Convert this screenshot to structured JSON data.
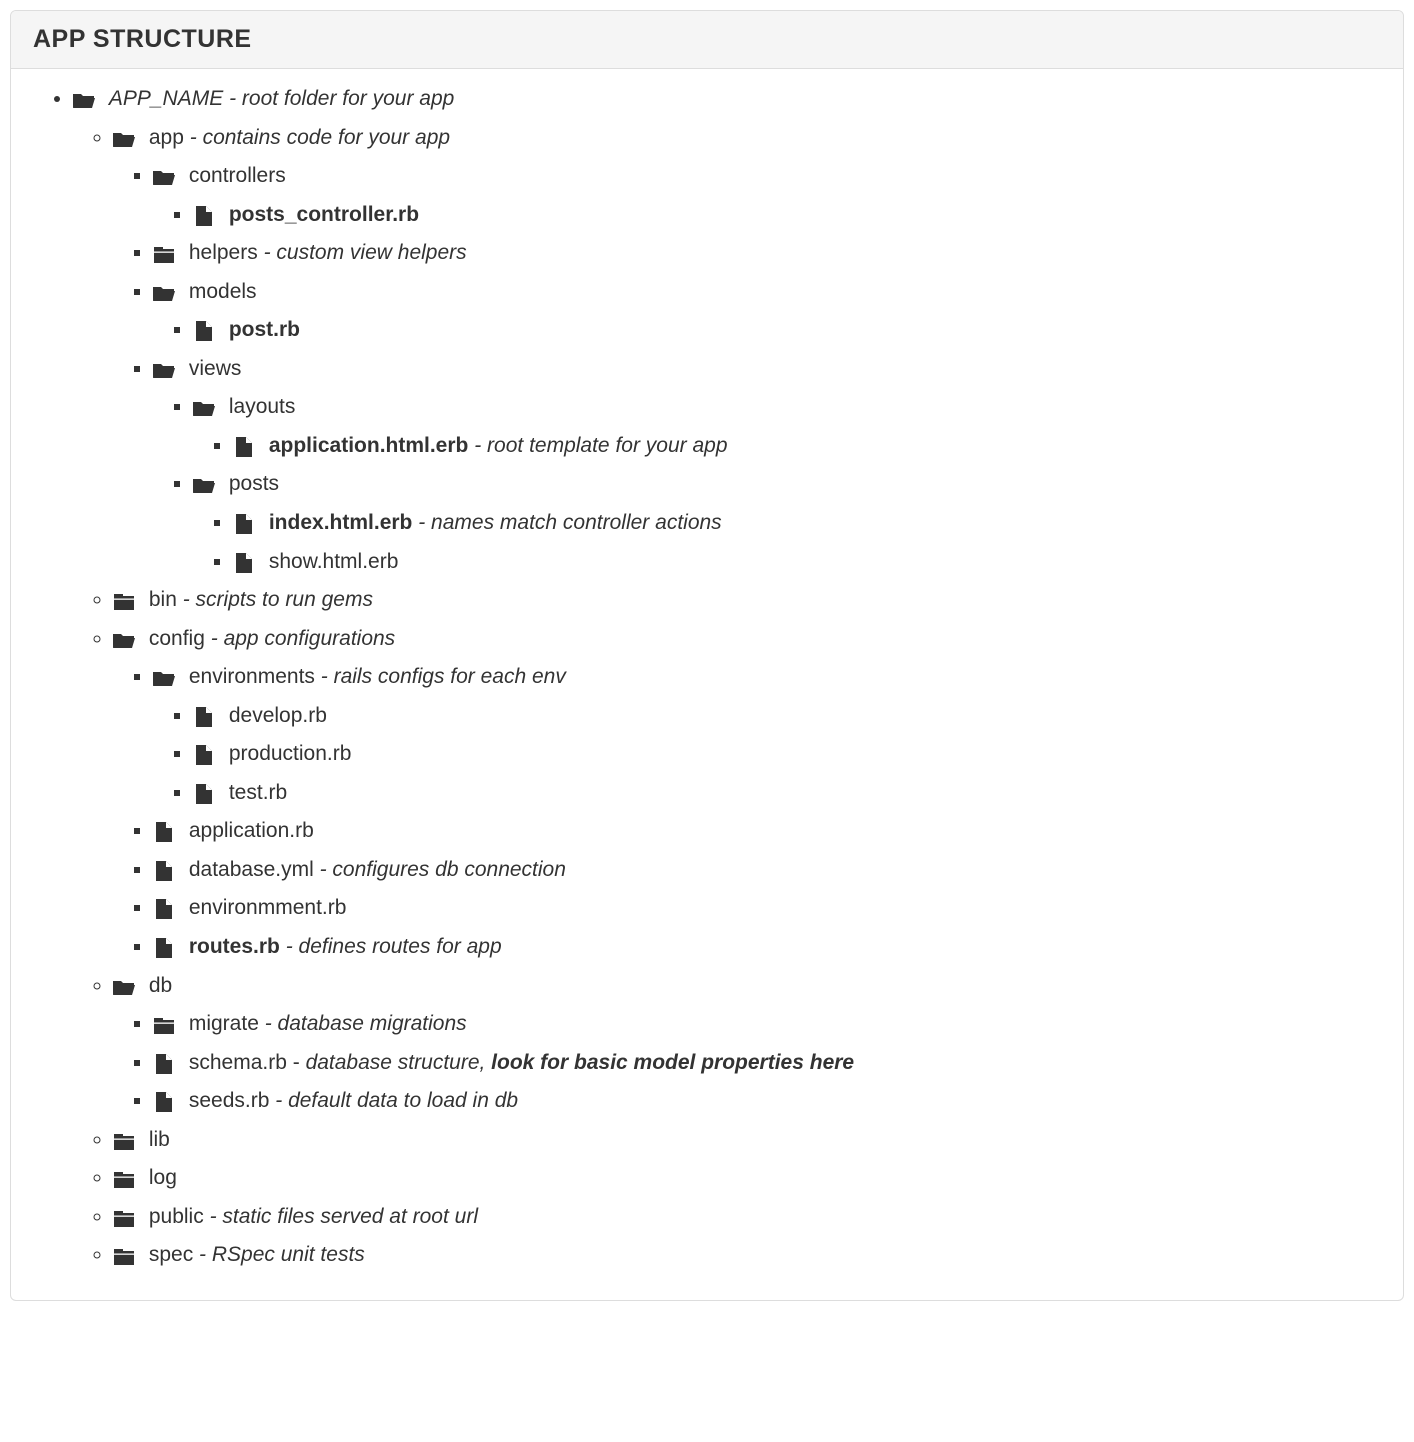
{
  "header": "APP STRUCTURE",
  "tree": {
    "root": {
      "name": "APP_NAME",
      "desc": "root folder for your app",
      "app": {
        "name": "app",
        "desc": "contains code for your app",
        "controllers": {
          "name": "controllers",
          "posts_controller": {
            "name": "posts_controller.rb"
          }
        },
        "helpers": {
          "name": "helpers",
          "desc": "custom view helpers"
        },
        "models": {
          "name": "models",
          "post": {
            "name": "post.rb"
          }
        },
        "views": {
          "name": "views",
          "layouts": {
            "name": "layouts",
            "application": {
              "name": "application.html.erb",
              "desc": "root template for your app"
            }
          },
          "posts": {
            "name": "posts",
            "index": {
              "name": "index.html.erb",
              "desc": "names match controller actions"
            },
            "show": {
              "name": "show.html.erb"
            }
          }
        }
      },
      "bin": {
        "name": "bin",
        "desc": "scripts to run gems"
      },
      "config": {
        "name": "config",
        "desc": "app configurations",
        "environments": {
          "name": "environments",
          "desc": "rails configs for each env",
          "develop": {
            "name": "develop.rb"
          },
          "production": {
            "name": "production.rb"
          },
          "test": {
            "name": "test.rb"
          }
        },
        "application": {
          "name": "application.rb"
        },
        "database": {
          "name": "database.yml",
          "desc": "configures db connection"
        },
        "environment": {
          "name": "environmment.rb"
        },
        "routes": {
          "name": "routes.rb",
          "desc": "defines routes for app"
        }
      },
      "db": {
        "name": "db",
        "migrate": {
          "name": "migrate",
          "desc": "database migrations"
        },
        "schema": {
          "name": "schema.rb",
          "desc_plain": "database structure, ",
          "desc_bold": "look for basic model properties here"
        },
        "seeds": {
          "name": "seeds.rb",
          "desc": "default data to load in db"
        }
      },
      "lib": {
        "name": "lib"
      },
      "log": {
        "name": "log"
      },
      "public": {
        "name": "public",
        "desc": "static files served at root url"
      },
      "spec": {
        "name": "spec",
        "desc": "RSpec unit tests"
      }
    }
  }
}
